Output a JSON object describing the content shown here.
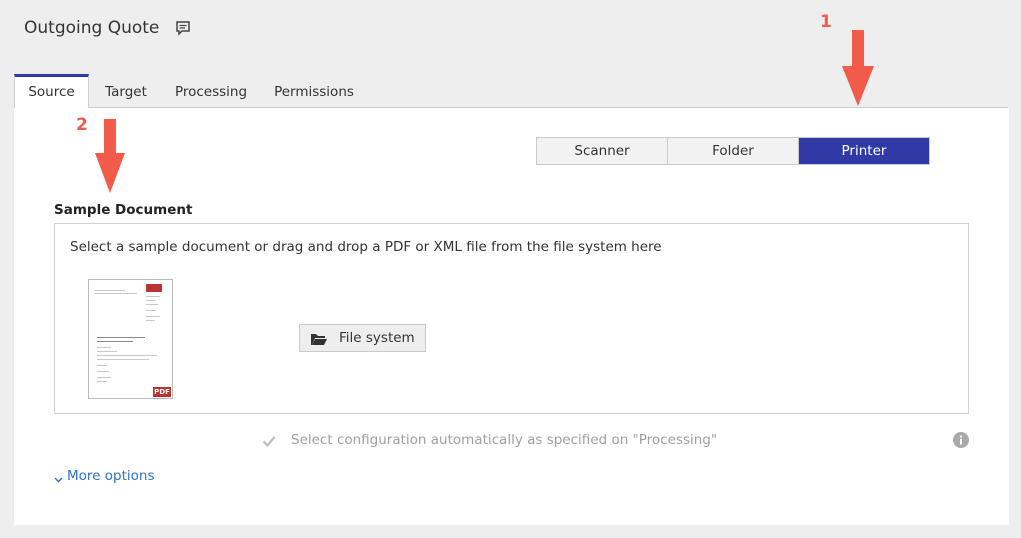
{
  "header": {
    "title": "Outgoing Quote",
    "comment_icon": "comment-icon"
  },
  "tabs": [
    {
      "label": "Source",
      "active": true
    },
    {
      "label": "Target",
      "active": false
    },
    {
      "label": "Processing",
      "active": false
    },
    {
      "label": "Permissions",
      "active": false
    }
  ],
  "source_selector": {
    "options": [
      {
        "label": "Scanner",
        "active": false
      },
      {
        "label": "Folder",
        "active": false
      },
      {
        "label": "Printer",
        "active": true
      }
    ],
    "active_color": "#2f3aa7"
  },
  "sample_document": {
    "heading": "Sample Document",
    "hint": "Select a sample document or drag and drop a PDF or XML file from the file system here",
    "thumbnail_badge": "PDF",
    "file_system_button": "File system",
    "file_system_icon": "folder-open-icon"
  },
  "auto_config": {
    "checked": true,
    "label": "Select configuration automatically as specified on \"Processing\"",
    "info_icon": "info-icon"
  },
  "more_options": {
    "label": "More options",
    "icon": "chevron-down-icon"
  },
  "annotations": [
    {
      "number": "1",
      "color": "#f25a4a"
    },
    {
      "number": "2",
      "color": "#f25a4a"
    }
  ]
}
